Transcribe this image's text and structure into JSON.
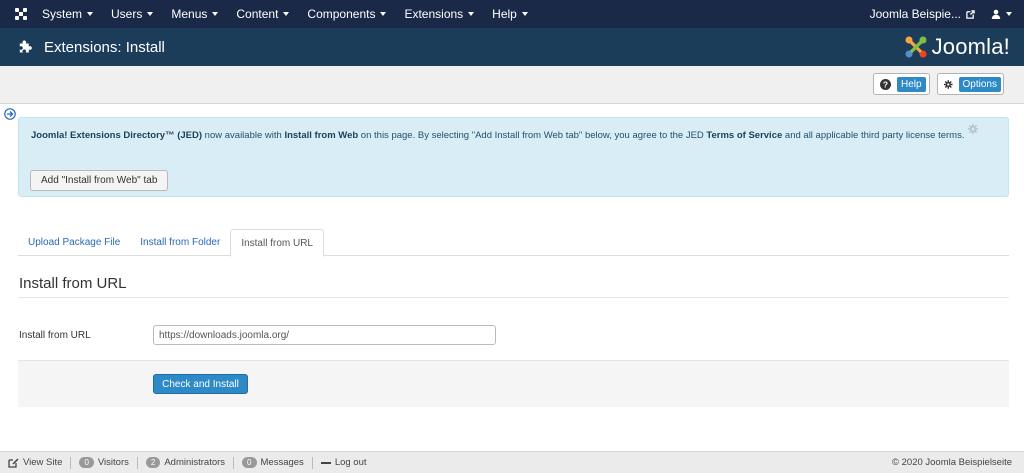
{
  "topnav": {
    "menu": [
      "System",
      "Users",
      "Menus",
      "Content",
      "Components",
      "Extensions",
      "Help"
    ],
    "site_link": "Joomla Beispie..."
  },
  "titlebar": {
    "title": "Extensions: Install",
    "logo_text": "Joomla!"
  },
  "toolbar": {
    "help_label": "Help",
    "options_label": "Options"
  },
  "alert": {
    "jed_name": "Joomla! Extensions Directory™ (JED)",
    "text_1": " now available with ",
    "install_from_web": "Install from Web",
    "text_2": " on this page. By selecting \"Add Install from Web tab\" below, you agree to the JED ",
    "terms": "Terms of Service",
    "text_3": " and all applicable third party license terms.",
    "button_label": "Add \"Install from Web\" tab"
  },
  "tabs": [
    "Upload Package File",
    "Install from Folder",
    "Install from URL"
  ],
  "section_title": "Install from URL",
  "form": {
    "label": "Install from URL",
    "url_value": "https://downloads.joomla.org/",
    "submit_label": "Check and Install"
  },
  "footer": {
    "view_site": "View Site",
    "visitors_count": "0",
    "visitors_label": "Visitors",
    "admins_count": "2",
    "admins_label": "Administrators",
    "messages_count": "0",
    "messages_label": "Messages",
    "logout": "Log out",
    "copyright": "© 2020 Joomla Beispielseite"
  },
  "colors": {
    "topnav_bg": "#1a2947",
    "titlebar_bg": "#1c3d5a",
    "primary": "#2d8ac7",
    "alert_bg": "#d9edf7"
  }
}
